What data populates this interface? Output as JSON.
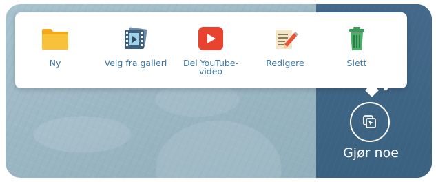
{
  "menu": {
    "items": [
      {
        "label": "Ny",
        "icon": "folder-icon"
      },
      {
        "label": "Velg fra galleri",
        "icon": "film-gallery-icon"
      },
      {
        "label_line1": "Del YouTube-",
        "label_line2": "video",
        "icon": "youtube-icon"
      },
      {
        "label": "Redigere",
        "icon": "edit-icon"
      },
      {
        "label": "Slett",
        "icon": "trash-icon"
      }
    ]
  },
  "action": {
    "label": "Gjør noe",
    "icon": "select-cursor-icon"
  },
  "colors": {
    "background": "#9fbac6",
    "side_panel": "#3d6581",
    "menu_label": "#3a77a6",
    "folder": "#f6b72a",
    "youtube": "#e8432f",
    "trash": "#4caf6a"
  }
}
